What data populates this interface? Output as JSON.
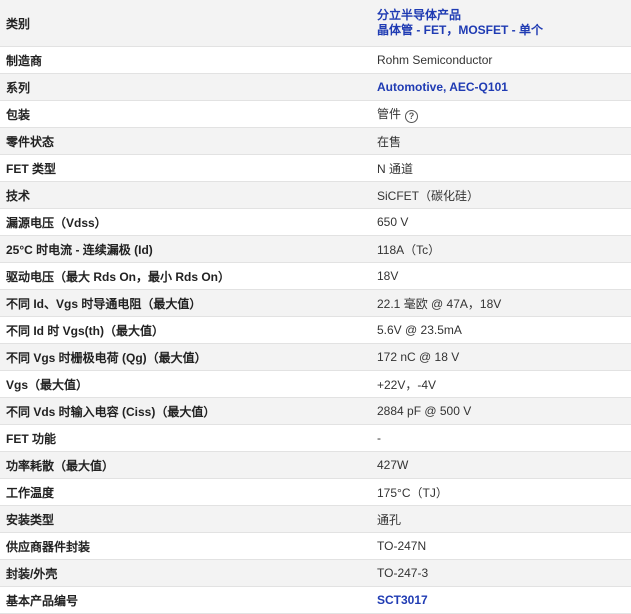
{
  "rows": {
    "category": {
      "label": "类别",
      "links": [
        "分立半导体产品",
        "晶体管 - FET，MOSFET - 单个"
      ]
    },
    "manufacturer": {
      "label": "制造商",
      "value": "Rohm Semiconductor"
    },
    "series": {
      "label": "系列",
      "value": "Automotive, AEC-Q101"
    },
    "packaging": {
      "label": "包装",
      "value": "管件"
    },
    "part_status": {
      "label": "零件状态",
      "value": "在售"
    },
    "fet_type": {
      "label": "FET 类型",
      "value": "N 通道"
    },
    "technology": {
      "label": "技术",
      "value": "SiCFET（碳化硅）"
    },
    "vdss": {
      "label": "漏源电压（Vdss）",
      "value": "650 V"
    },
    "id_25c": {
      "label": "25°C 时电流 - 连续漏极 (Id)",
      "value": "118A（Tc）"
    },
    "drive_voltage": {
      "label": "驱动电压（最大 Rds On，最小 Rds On）",
      "value": "18V"
    },
    "rds_on": {
      "label": "不同 Id、Vgs 时导通电阻（最大值）",
      "value": "22.1 毫欧 @ 47A，18V"
    },
    "vgs_th": {
      "label": "不同 Id 时 Vgs(th)（最大值）",
      "value": "5.6V @ 23.5mA"
    },
    "qg": {
      "label": "不同 Vgs 时栅极电荷 (Qg)（最大值）",
      "value": "172 nC @ 18 V"
    },
    "vgs_max": {
      "label": "Vgs（最大值）",
      "value": "+22V，-4V"
    },
    "ciss": {
      "label": "不同 Vds 时输入电容 (Ciss)（最大值）",
      "value": "2884 pF @ 500 V"
    },
    "fet_feature": {
      "label": "FET 功能",
      "value": "-"
    },
    "power": {
      "label": "功率耗散（最大值）",
      "value": "427W"
    },
    "temp": {
      "label": "工作温度",
      "value": "175°C（TJ）"
    },
    "mount": {
      "label": "安装类型",
      "value": "通孔"
    },
    "supplier_pkg": {
      "label": "供应商器件封装",
      "value": "TO-247N"
    },
    "case": {
      "label": "封装/外壳",
      "value": "TO-247-3"
    },
    "base_part": {
      "label": "基本产品编号",
      "value": "SCT3017"
    }
  },
  "icons": {
    "help": "?"
  },
  "colors": {
    "link": "#1f3bb3",
    "row_alt": "#f3f3f3"
  }
}
